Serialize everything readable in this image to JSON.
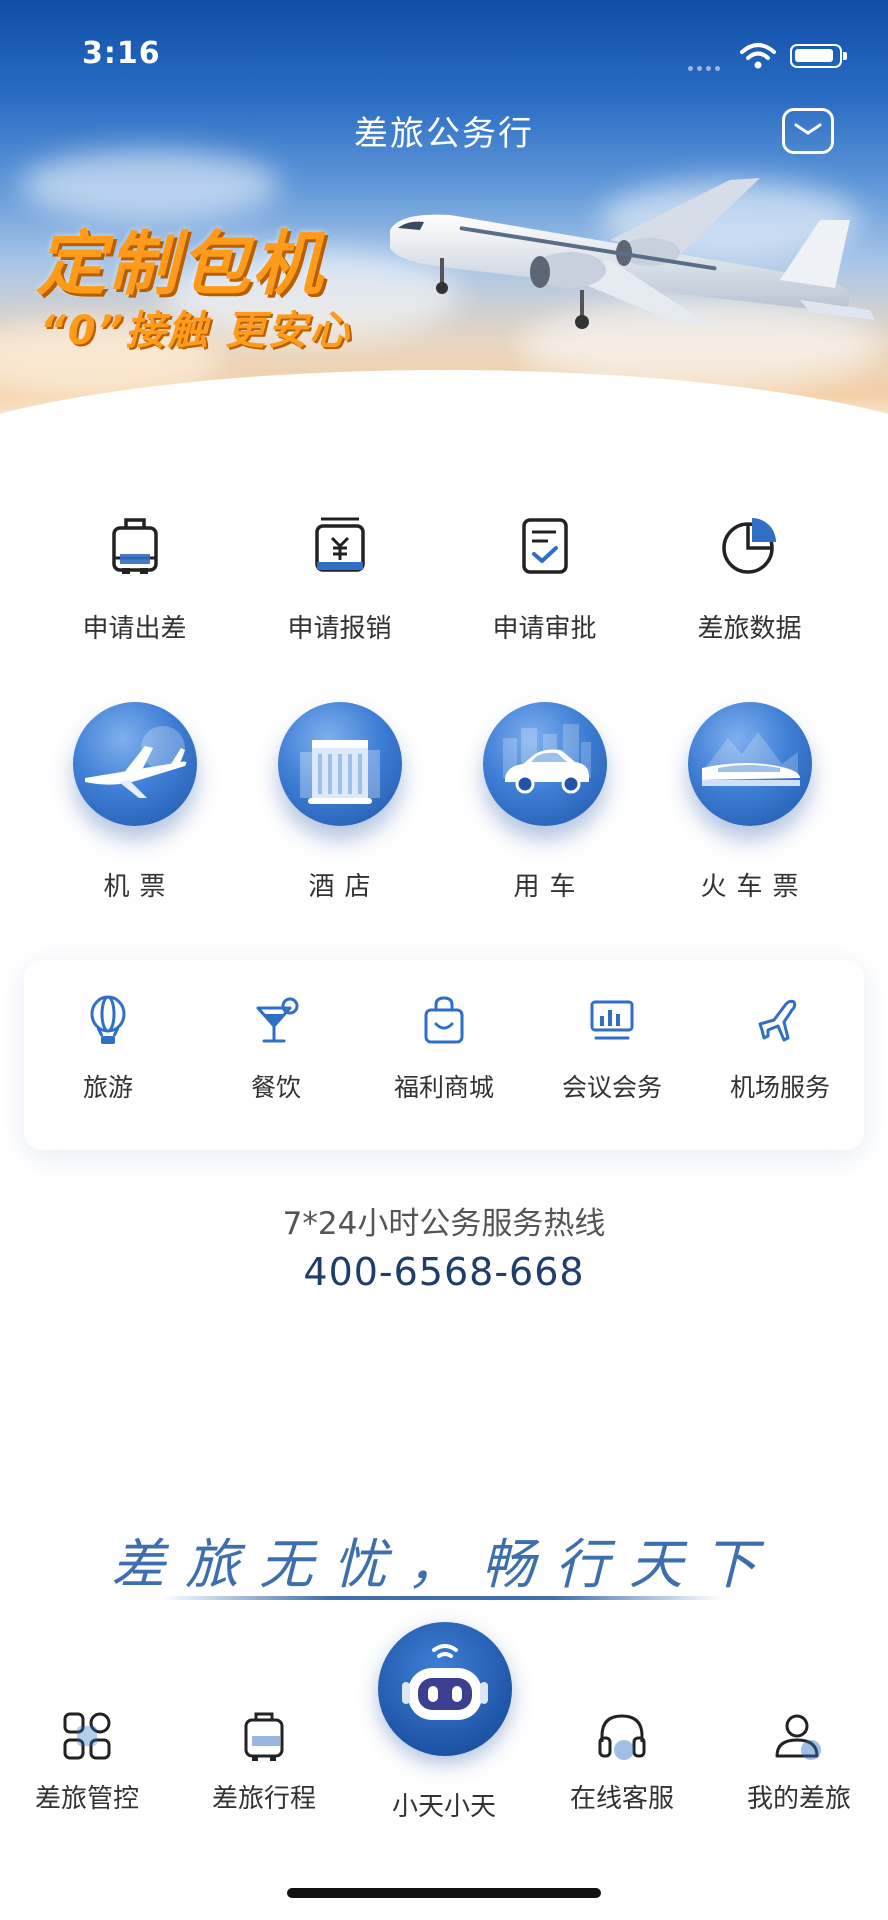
{
  "status_bar": {
    "time": "3:16"
  },
  "header": {
    "title": "差旅公务行",
    "message_icon": "mail-icon"
  },
  "banner": {
    "headline": "定制包机",
    "subline": "“0”接触 更安心"
  },
  "quick_actions": [
    {
      "label": "申请出差",
      "icon": "suitcase-icon"
    },
    {
      "label": "申请报销",
      "icon": "yuan-receipt-icon"
    },
    {
      "label": "申请审批",
      "icon": "approval-doc-icon"
    },
    {
      "label": "差旅数据",
      "icon": "pie-chart-icon"
    }
  ],
  "services": [
    {
      "label": "机票",
      "icon": "airplane-icon"
    },
    {
      "label": "酒店",
      "icon": "hotel-icon"
    },
    {
      "label": "用车",
      "icon": "car-icon"
    },
    {
      "label": "火车票",
      "icon": "train-icon"
    }
  ],
  "extra_services": [
    {
      "label": "旅游",
      "icon": "hot-air-balloon-icon"
    },
    {
      "label": "餐饮",
      "icon": "cocktail-icon"
    },
    {
      "label": "福利商城",
      "icon": "shopping-bag-icon"
    },
    {
      "label": "会议会务",
      "icon": "presentation-screen-icon"
    },
    {
      "label": "机场服务",
      "icon": "plane-icon"
    }
  ],
  "hotline": {
    "title": "7*24小时公务服务热线",
    "number": "400-6568-668"
  },
  "slogan": "差旅无忧，畅行天下",
  "bottom_nav": [
    {
      "label": "差旅管控",
      "icon": "grid-icon"
    },
    {
      "label": "差旅行程",
      "icon": "luggage-icon"
    },
    {
      "label": "小天小天",
      "icon": "robot-assistant-icon"
    },
    {
      "label": "在线客服",
      "icon": "headset-icon"
    },
    {
      "label": "我的差旅",
      "icon": "user-icon"
    }
  ],
  "colors": {
    "brand_blue": "#1f55a8",
    "accent_orange": "#ff9b1a",
    "icon_blue": "#2f6fc4"
  }
}
